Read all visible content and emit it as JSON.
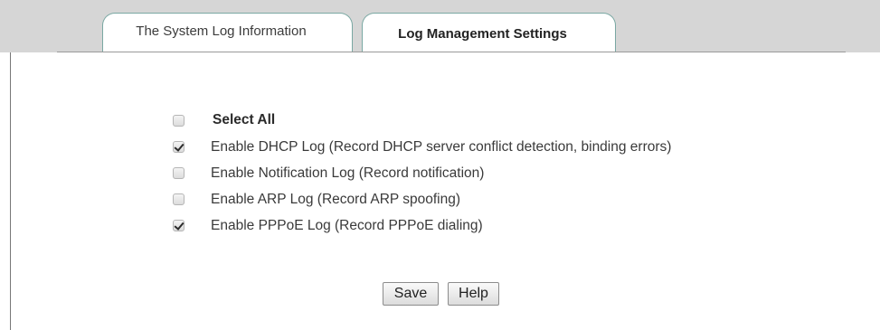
{
  "tabs": [
    {
      "label": "The System Log Information",
      "active": false
    },
    {
      "label": "Log Management Settings",
      "active": true
    }
  ],
  "options": {
    "select_all": {
      "label": "Select All",
      "checked": false
    },
    "items": [
      {
        "label": "Enable DHCP Log (Record DHCP server conflict detection, binding errors)",
        "checked": true
      },
      {
        "label": "Enable Notification Log (Record notification)",
        "checked": false
      },
      {
        "label": "Enable ARP Log (Record ARP spoofing)",
        "checked": false
      },
      {
        "label": "Enable PPPoE Log (Record PPPoE dialing)",
        "checked": true
      }
    ]
  },
  "buttons": {
    "save_label": "Save",
    "help_label": "Help"
  },
  "colors": {
    "tab_border": "#7aa8a3",
    "tabbar_background": "#d6d6d6"
  }
}
